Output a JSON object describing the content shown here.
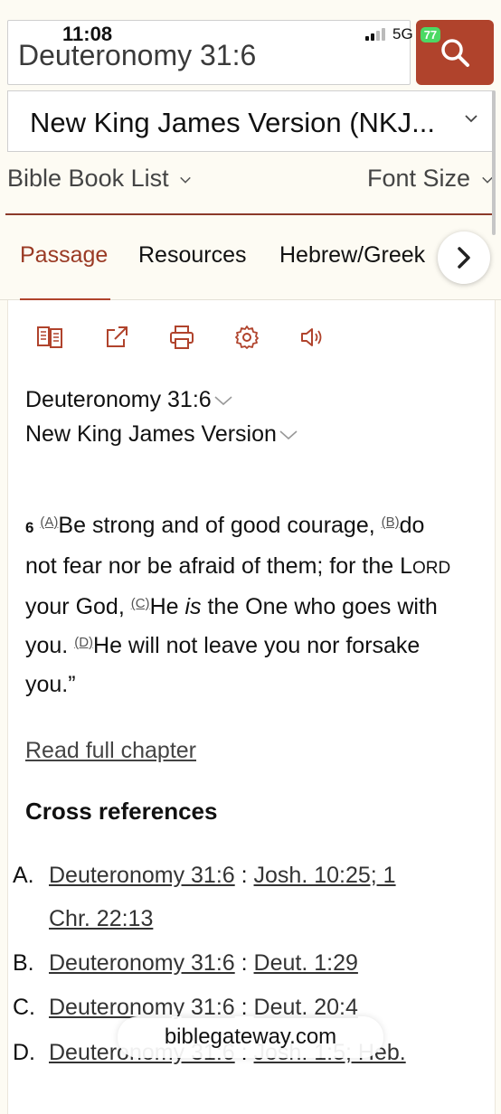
{
  "status": {
    "time": "11:08",
    "network": "5G",
    "battery": "77"
  },
  "search": {
    "query": "Deuteronomy 31:6"
  },
  "version": {
    "label": "New King James Version (NKJ..."
  },
  "menu": {
    "book_list": "Bible Book List",
    "font_size": "Font Size"
  },
  "tabs": [
    {
      "label": "Passage"
    },
    {
      "label": "Resources"
    },
    {
      "label": "Hebrew/Greek"
    }
  ],
  "passage": {
    "reference": "Deuteronomy 31:6",
    "version": "New King James Version",
    "verse_number": "6",
    "refs": [
      "(A)",
      "(B)",
      "(C)",
      "(D)"
    ],
    "text1": "Be strong and of good courage, ",
    "text2": "do not fear nor be afraid of them; for the ",
    "lord_first": "L",
    "lord_rest": "ORD",
    "text3": " your God, ",
    "text4": "He ",
    "text_is": "is",
    "text5": " the One who goes with you. ",
    "text6": "He will not leave you nor forsake you.”",
    "read_full": "Read full chapter"
  },
  "cross_references": {
    "title": "Cross references",
    "items": [
      {
        "letter": "A.",
        "source": "Deuteronomy 31:6",
        "sep": " : ",
        "targets": "Josh. 10:25; 1",
        "targets2": "Chr. 22:13"
      },
      {
        "letter": "B.",
        "source": "Deuteronomy 31:6",
        "sep": " : ",
        "targets": "Deut. 1:29"
      },
      {
        "letter": "C.",
        "source": "Deuteronomy 31:6",
        "sep": " : ",
        "targets": "Deut. 20:4"
      },
      {
        "letter": "D.",
        "source": "Deuteronomy 31:6",
        "sep": " : ",
        "targets": "Josh. 1:5; Heb."
      }
    ]
  },
  "footer": {
    "site": "biblegateway.com"
  },
  "colors": {
    "accent": "#b0432c",
    "background": "#fdfbf3",
    "battery": "#4cd964"
  }
}
